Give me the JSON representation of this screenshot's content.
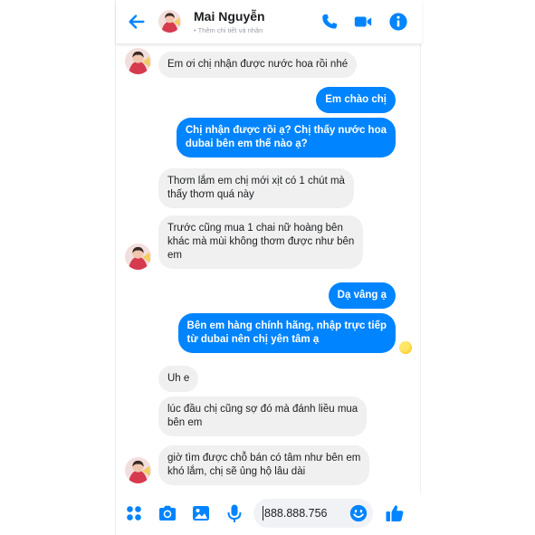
{
  "header": {
    "contact_name": "Mai Nguyễn",
    "subtitle": "• Thêm chi tiết và nhãn"
  },
  "messages": [
    {
      "side": "in",
      "text": "Em ơi chị nhận được nước hoa rồi nhé"
    },
    {
      "side": "out",
      "text": "Em chào chị"
    },
    {
      "side": "out",
      "lines": [
        "Chị nhận được rồi ạ? Chị thấy nước hoa",
        "dubai bên em thế nào ạ?"
      ]
    },
    {
      "side": "in",
      "lines": [
        "Thơm lắm em chị mới xịt có 1 chút mà",
        "thấy thơm quá này"
      ]
    },
    {
      "side": "in",
      "lines": [
        "Trước cũng mua 1 chai nữ hoàng bên",
        "khác mà mùi không thơm được như bên",
        "em"
      ]
    },
    {
      "side": "out",
      "text": "Dạ vâng ạ"
    },
    {
      "side": "out",
      "lines": [
        "Bên em hàng chính hãng, nhập trực tiếp",
        "từ dubai nên chị yên tâm ạ"
      ]
    },
    {
      "side": "in",
      "text": "Uh e"
    },
    {
      "side": "in",
      "lines": [
        "lúc đầu chị cũng sợ đó mà đánh liều mua",
        "bên em"
      ]
    },
    {
      "side": "in",
      "lines": [
        "giờ tìm được chỗ bán có tâm như bên em",
        "khó lắm, chị sẽ ủng hộ lâu dài"
      ]
    }
  ],
  "composer": {
    "input_value": "888.888.756"
  },
  "icons": {
    "back": "arrow-left-icon",
    "call": "phone-icon",
    "video": "video-camera-icon",
    "info": "info-icon",
    "apps": "grid-dots-icon",
    "camera": "camera-icon",
    "gallery": "image-icon",
    "mic": "microphone-icon",
    "emoji": "smiley-icon",
    "like": "thumbs-up-icon",
    "seen": "seen-avatar-icon"
  },
  "colors": {
    "accent": "#0084ff",
    "incoming_bubble": "#f0f0f0",
    "outgoing_text": "#ffffff"
  }
}
